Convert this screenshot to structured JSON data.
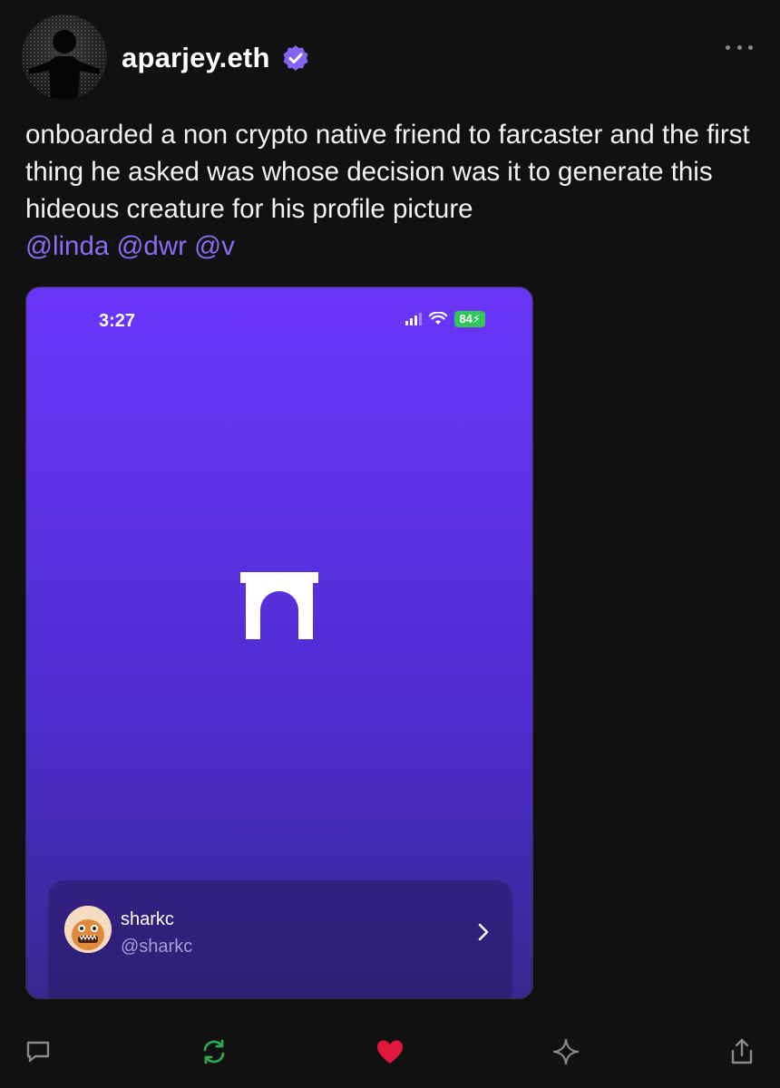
{
  "post": {
    "author": {
      "username": "aparjey.eth",
      "verified": true,
      "avatar_icon": "silhouette-avatar"
    },
    "text": "onboarded a non crypto native friend to farcaster and the first thing he asked was whose decision was it to generate this hideous creature for his profile picture",
    "mentions": [
      "@linda",
      "@dwr",
      "@v"
    ]
  },
  "embed": {
    "status_bar": {
      "time": "3:27",
      "battery": "84"
    },
    "logo_icon": "farcaster-arch-icon",
    "account": {
      "name": "sharkc",
      "handle": "@sharkc"
    }
  },
  "actions": [
    {
      "icon": "reply-icon",
      "color": "#8a8a8a"
    },
    {
      "icon": "recast-icon",
      "color": "#2ea44f"
    },
    {
      "icon": "like-heart-icon",
      "color": "#e0183c"
    },
    {
      "icon": "sparkle-icon",
      "color": "#8a8a8a"
    },
    {
      "icon": "share-icon",
      "color": "#8a8a8a"
    }
  ],
  "colors": {
    "background": "#111111",
    "mention": "#8b6cf2",
    "verified_badge": "#8465f0",
    "embed_top": "#6a36fb",
    "embed_bottom": "#38278f"
  }
}
